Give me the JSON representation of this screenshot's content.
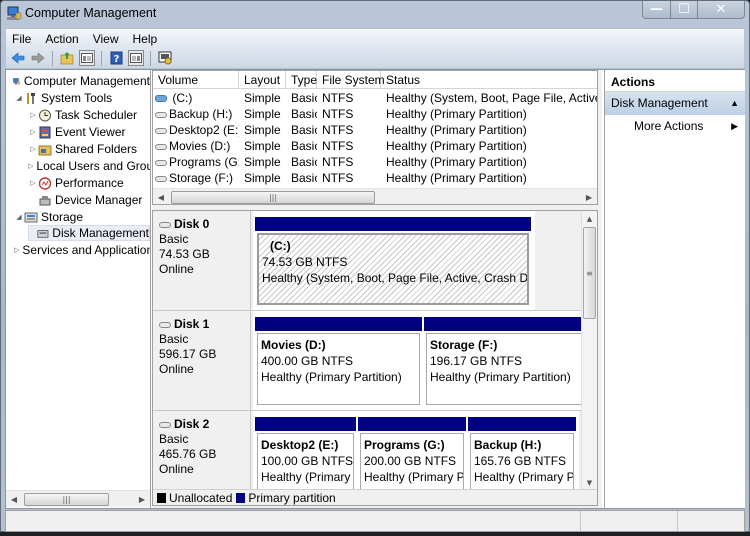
{
  "window": {
    "title": "Computer Management",
    "controls": {
      "minimize": "—",
      "maximize": "☐",
      "close": "✕"
    }
  },
  "menu": [
    "File",
    "Action",
    "View",
    "Help"
  ],
  "toolbar": {
    "buttons": [
      {
        "name": "back",
        "icon": "←"
      },
      {
        "name": "forward",
        "icon": "→"
      },
      {
        "name": "up-folder",
        "icon": "↑"
      },
      {
        "name": "show-hide-console-tree",
        "icon": "▤"
      },
      {
        "name": "help",
        "icon": "?"
      },
      {
        "name": "show-hide-action-pane",
        "icon": "▥"
      },
      {
        "name": "properties",
        "icon": "⚙"
      }
    ]
  },
  "tree": {
    "items": [
      {
        "label": "Computer Management",
        "level": 0,
        "expander": "",
        "icon": "computer"
      },
      {
        "label": "System Tools",
        "level": 1,
        "expander": "◢",
        "icon": "tools"
      },
      {
        "label": "Task Scheduler",
        "level": 2,
        "expander": "▷",
        "icon": "clock"
      },
      {
        "label": "Event Viewer",
        "level": 2,
        "expander": "▷",
        "icon": "event-log"
      },
      {
        "label": "Shared Folders",
        "level": 2,
        "expander": "▷",
        "icon": "shared-folder"
      },
      {
        "label": "Local Users and Groups",
        "level": 2,
        "expander": "▷",
        "icon": "users"
      },
      {
        "label": "Performance",
        "level": 2,
        "expander": "▷",
        "icon": "performance"
      },
      {
        "label": "Device Manager",
        "level": 2,
        "expander": "",
        "icon": "device"
      },
      {
        "label": "Storage",
        "level": 1,
        "expander": "◢",
        "icon": "storage"
      },
      {
        "label": "Disk Management",
        "level": 2,
        "expander": "",
        "icon": "disk",
        "selected": true
      },
      {
        "label": "Services and Applications",
        "level": 1,
        "expander": "▷",
        "icon": "services"
      }
    ]
  },
  "volume_list": {
    "columns": [
      "Volume",
      "Layout",
      "Type",
      "File System",
      "Status"
    ],
    "rows": [
      {
        "volume": "(C:)",
        "layout": "Simple",
        "type": "Basic",
        "fs": "NTFS",
        "status": "Healthy (System, Boot, Page File, Active, Crash Dump, Primary Partition)",
        "system": true
      },
      {
        "volume": "Backup (H:)",
        "layout": "Simple",
        "type": "Basic",
        "fs": "NTFS",
        "status": "Healthy (Primary Partition)"
      },
      {
        "volume": "Desktop2 (E:)",
        "layout": "Simple",
        "type": "Basic",
        "fs": "NTFS",
        "status": "Healthy (Primary Partition)"
      },
      {
        "volume": "Movies (D:)",
        "layout": "Simple",
        "type": "Basic",
        "fs": "NTFS",
        "status": "Healthy (Primary Partition)"
      },
      {
        "volume": "Programs (G:)",
        "layout": "Simple",
        "type": "Basic",
        "fs": "NTFS",
        "status": "Healthy (Primary Partition)"
      },
      {
        "volume": "Storage (F:)",
        "layout": "Simple",
        "type": "Basic",
        "fs": "NTFS",
        "status": "Healthy (Primary Partition)"
      }
    ]
  },
  "disks": [
    {
      "name": "Disk 0",
      "type": "Basic",
      "size": "74.53 GB",
      "state": "Online",
      "partitions": [
        {
          "title": "(C:)",
          "size": "74.53 GB NTFS",
          "status": "Healthy (System, Boot, Page File, Active, Crash Dump, Primary Partition)",
          "selected": true
        }
      ]
    },
    {
      "name": "Disk 1",
      "type": "Basic",
      "size": "596.17 GB",
      "state": "Online",
      "partitions": [
        {
          "title": "Movies  (D:)",
          "size": "400.00 GB NTFS",
          "status": "Healthy (Primary Partition)"
        },
        {
          "title": "Storage  (F:)",
          "size": "196.17 GB NTFS",
          "status": "Healthy (Primary Partition)"
        }
      ]
    },
    {
      "name": "Disk 2",
      "type": "Basic",
      "size": "465.76 GB",
      "state": "Online",
      "partitions": [
        {
          "title": "Desktop2  (E:)",
          "size": "100.00 GB NTFS",
          "status": "Healthy (Primary Partition)"
        },
        {
          "title": "Programs  (G:)",
          "size": "200.00 GB NTFS",
          "status": "Healthy (Primary Partition)"
        },
        {
          "title": "Backup  (H:)",
          "size": "165.76 GB NTFS",
          "status": "Healthy (Primary Partition)"
        }
      ]
    }
  ],
  "legend": [
    {
      "label": "Unallocated",
      "color": "#000000"
    },
    {
      "label": "Primary partition",
      "color": "#000080"
    }
  ],
  "actions": {
    "header": "Actions",
    "section": "Disk Management",
    "items": [
      "More Actions"
    ]
  },
  "colors": {
    "primary_partition": "#000080",
    "unallocated": "#000000",
    "selection": "#e9eef4"
  }
}
